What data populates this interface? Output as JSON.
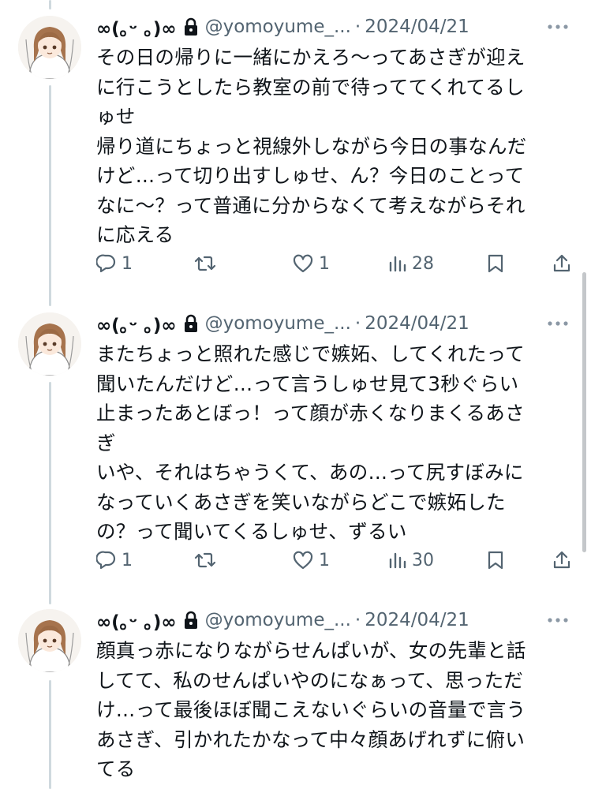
{
  "colors": {
    "thread_line": "#cfd9de",
    "secondary_text": "#536471",
    "primary_text": "#0f1419"
  },
  "tweets": [
    {
      "display_name": "∞(｡ᵕ ｡)∞",
      "lock_icon": "lock-icon",
      "handle": "@yomoyume_...",
      "dot": "·",
      "date": "2024/04/21",
      "text": "その日の帰りに一緒にかえろ〜ってあさぎが迎え\nに行こうとしたら教室の前で待っててくれてるし\nゅせ\n帰り道にちょっと視線外しながら今日の事なんだ\nけど…って切り出すしゅせ、ん？今日のことって\nなに〜？って普通に分からなくて考えながらそれ\nに応える",
      "replies": "1",
      "retweets": "",
      "likes": "1",
      "views": "28"
    },
    {
      "display_name": "∞(｡ᵕ ｡)∞",
      "lock_icon": "lock-icon",
      "handle": "@yomoyume_...",
      "dot": "·",
      "date": "2024/04/21",
      "text": "またちょっと照れた感じで嫉妬、してくれたって\n聞いたんだけど…って言うしゅせ見て3秒ぐらい\n止まったあとぼっ！って顔が赤くなりまくるあさ\nぎ\nいや、それはちゃうくて、あの…って尻すぼみに\nなっていくあさぎを笑いながらどこで嫉妬した\nの？って聞いてくるしゅせ、ずるい",
      "replies": "1",
      "retweets": "",
      "likes": "1",
      "views": "30"
    },
    {
      "display_name": "∞(｡ᵕ ｡)∞",
      "lock_icon": "lock-icon",
      "handle": "@yomoyume_...",
      "dot": "·",
      "date": "2024/04/21",
      "text": "顔真っ赤になりながらせんぱいが、女の先輩と話\nしてて、私のせんぱいやのになぁって、思っただ\nけ…って最後ほぼ聞こえないぐらいの音量で言う\nあさぎ、引かれたかなって中々顔あげれずに俯い\nてる"
    }
  ]
}
